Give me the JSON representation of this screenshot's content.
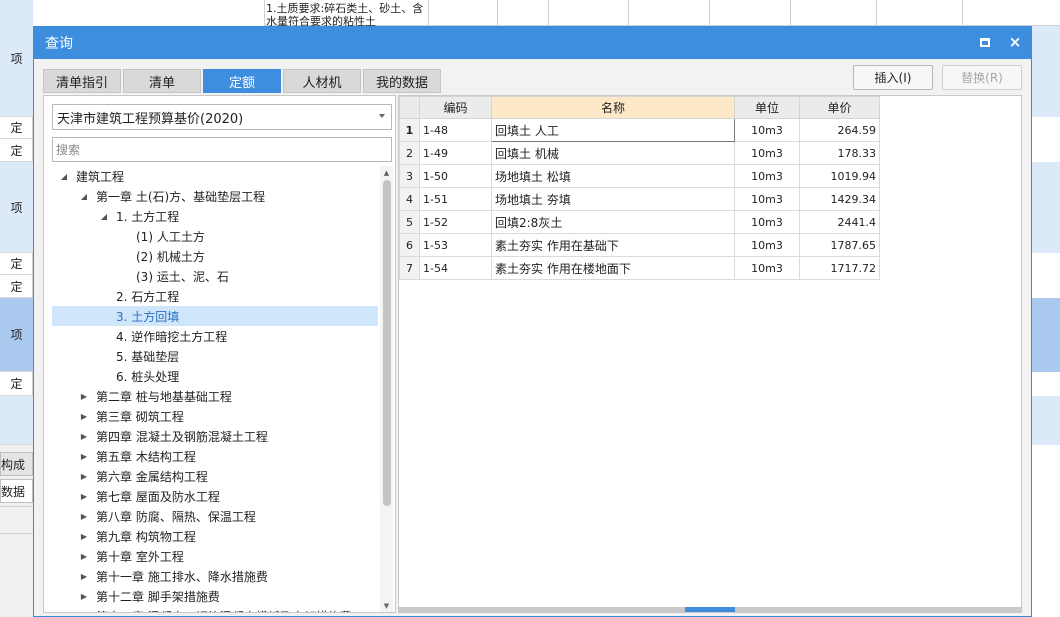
{
  "background": {
    "top_cell_text": "1.土质要求:碎石类土、砂土、含水量符合要求的粘性土",
    "left_labels": [
      "项",
      "定",
      "定",
      "项",
      "定",
      "定",
      "项",
      "定"
    ],
    "bottom_tab1": "构成",
    "bottom_tab2": "数据"
  },
  "dialog": {
    "title": "查询",
    "maximize_icon": "maximize-icon",
    "close_icon": "×"
  },
  "tabs": [
    {
      "label": "清单指引",
      "active": false
    },
    {
      "label": "清单",
      "active": false
    },
    {
      "label": "定额",
      "active": true
    },
    {
      "label": "人材机",
      "active": false
    },
    {
      "label": "我的数据",
      "active": false
    }
  ],
  "buttons": {
    "insert": "插入(I)",
    "replace": "替换(R)"
  },
  "left": {
    "library": "天津市建筑工程预算基价(2020)",
    "search_placeholder": "搜索",
    "tree": [
      {
        "label": "建筑工程",
        "level": 0,
        "toggle": "expanded"
      },
      {
        "label": "第一章 土(石)方、基础垫层工程",
        "level": 1,
        "toggle": "expanded"
      },
      {
        "label": "1. 土方工程",
        "level": 2,
        "toggle": "expanded"
      },
      {
        "label": "(1) 人工土方",
        "level": 3,
        "toggle": "none"
      },
      {
        "label": "(2) 机械土方",
        "level": 3,
        "toggle": "none"
      },
      {
        "label": "(3) 运土、泥、石",
        "level": 3,
        "toggle": "none"
      },
      {
        "label": "2. 石方工程",
        "level": 2,
        "toggle": "none"
      },
      {
        "label": "3. 土方回填",
        "level": 2,
        "toggle": "none",
        "selected": true
      },
      {
        "label": "4. 逆作暗挖土方工程",
        "level": 2,
        "toggle": "none"
      },
      {
        "label": "5. 基础垫层",
        "level": 2,
        "toggle": "none"
      },
      {
        "label": "6. 桩头处理",
        "level": 2,
        "toggle": "none"
      },
      {
        "label": "第二章 桩与地基基础工程",
        "level": 1,
        "toggle": "collapsed"
      },
      {
        "label": "第三章 砌筑工程",
        "level": 1,
        "toggle": "collapsed"
      },
      {
        "label": "第四章 混凝土及钢筋混凝土工程",
        "level": 1,
        "toggle": "collapsed"
      },
      {
        "label": "第五章 木结构工程",
        "level": 1,
        "toggle": "collapsed"
      },
      {
        "label": "第六章 金属结构工程",
        "level": 1,
        "toggle": "collapsed"
      },
      {
        "label": "第七章 屋面及防水工程",
        "level": 1,
        "toggle": "collapsed"
      },
      {
        "label": "第八章 防腐、隔热、保温工程",
        "level": 1,
        "toggle": "collapsed"
      },
      {
        "label": "第九章 构筑物工程",
        "level": 1,
        "toggle": "collapsed"
      },
      {
        "label": "第十章 室外工程",
        "level": 1,
        "toggle": "collapsed"
      },
      {
        "label": "第十一章 施工排水、降水措施费",
        "level": 1,
        "toggle": "collapsed"
      },
      {
        "label": "第十二章 脚手架措施费",
        "level": 1,
        "toggle": "collapsed"
      },
      {
        "label": "第十三章 混凝土、钢筋混凝土模板及支架措施费",
        "level": 1,
        "toggle": "collapsed"
      }
    ]
  },
  "table": {
    "headers": {
      "code": "编码",
      "name": "名称",
      "unit": "单位",
      "price": "单价"
    },
    "rows": [
      {
        "n": "1",
        "code": "1-48",
        "name": "回填土 人工",
        "unit": "10m3",
        "price": "264.59"
      },
      {
        "n": "2",
        "code": "1-49",
        "name": "回填土 机械",
        "unit": "10m3",
        "price": "178.33"
      },
      {
        "n": "3",
        "code": "1-50",
        "name": "场地填土 松填",
        "unit": "10m3",
        "price": "1019.94"
      },
      {
        "n": "4",
        "code": "1-51",
        "name": "场地填土 夯填",
        "unit": "10m3",
        "price": "1429.34"
      },
      {
        "n": "5",
        "code": "1-52",
        "name": "回填2:8灰土",
        "unit": "10m3",
        "price": "2441.4"
      },
      {
        "n": "6",
        "code": "1-53",
        "name": "素土夯实 作用在基础下",
        "unit": "10m3",
        "price": "1787.65"
      },
      {
        "n": "7",
        "code": "1-54",
        "name": "素土夯实 作用在楼地面下",
        "unit": "10m3",
        "price": "1717.72"
      }
    ]
  }
}
